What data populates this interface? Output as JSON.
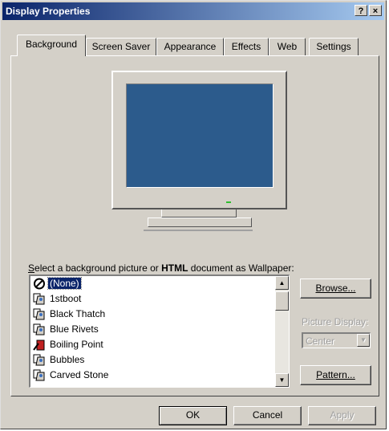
{
  "window": {
    "title": "Display Properties",
    "help_label": "?",
    "close_label": "×"
  },
  "tabs": [
    {
      "label": "Background",
      "active": true
    },
    {
      "label": "Screen Saver",
      "active": false
    },
    {
      "label": "Appearance",
      "active": false
    },
    {
      "label": "Effects",
      "active": false
    },
    {
      "label": "Web",
      "active": false
    },
    {
      "label": "Settings",
      "active": false
    }
  ],
  "background": {
    "label_prefix": "S",
    "label_mid": "elect a background picture or ",
    "label_html": "HTML",
    "label_suffix": " document as Wallpaper:",
    "wallpapers": [
      {
        "name": "(None)",
        "icon": "none-icon",
        "selected": true
      },
      {
        "name": "1stboot",
        "icon": "wallpaper-image-icon"
      },
      {
        "name": "Black Thatch",
        "icon": "wallpaper-image-icon"
      },
      {
        "name": "Blue Rivets",
        "icon": "wallpaper-image-icon"
      },
      {
        "name": "Boiling Point",
        "icon": "wallpaper-red-image-icon"
      },
      {
        "name": "Bubbles",
        "icon": "wallpaper-image-icon"
      },
      {
        "name": "Carved Stone",
        "icon": "wallpaper-image-icon"
      }
    ],
    "browse_label": "Browse...",
    "picture_display_label": "Picture Display:",
    "picture_display_value": "Center",
    "pattern_label": "Pattern..."
  },
  "footer": {
    "ok_label": "OK",
    "cancel_label": "Cancel",
    "apply_label": "Apply"
  },
  "colors": {
    "title_start": "#0a246a",
    "title_end": "#a6caf0",
    "screen": "#2c5b8c",
    "face": "#d4d0c8"
  }
}
